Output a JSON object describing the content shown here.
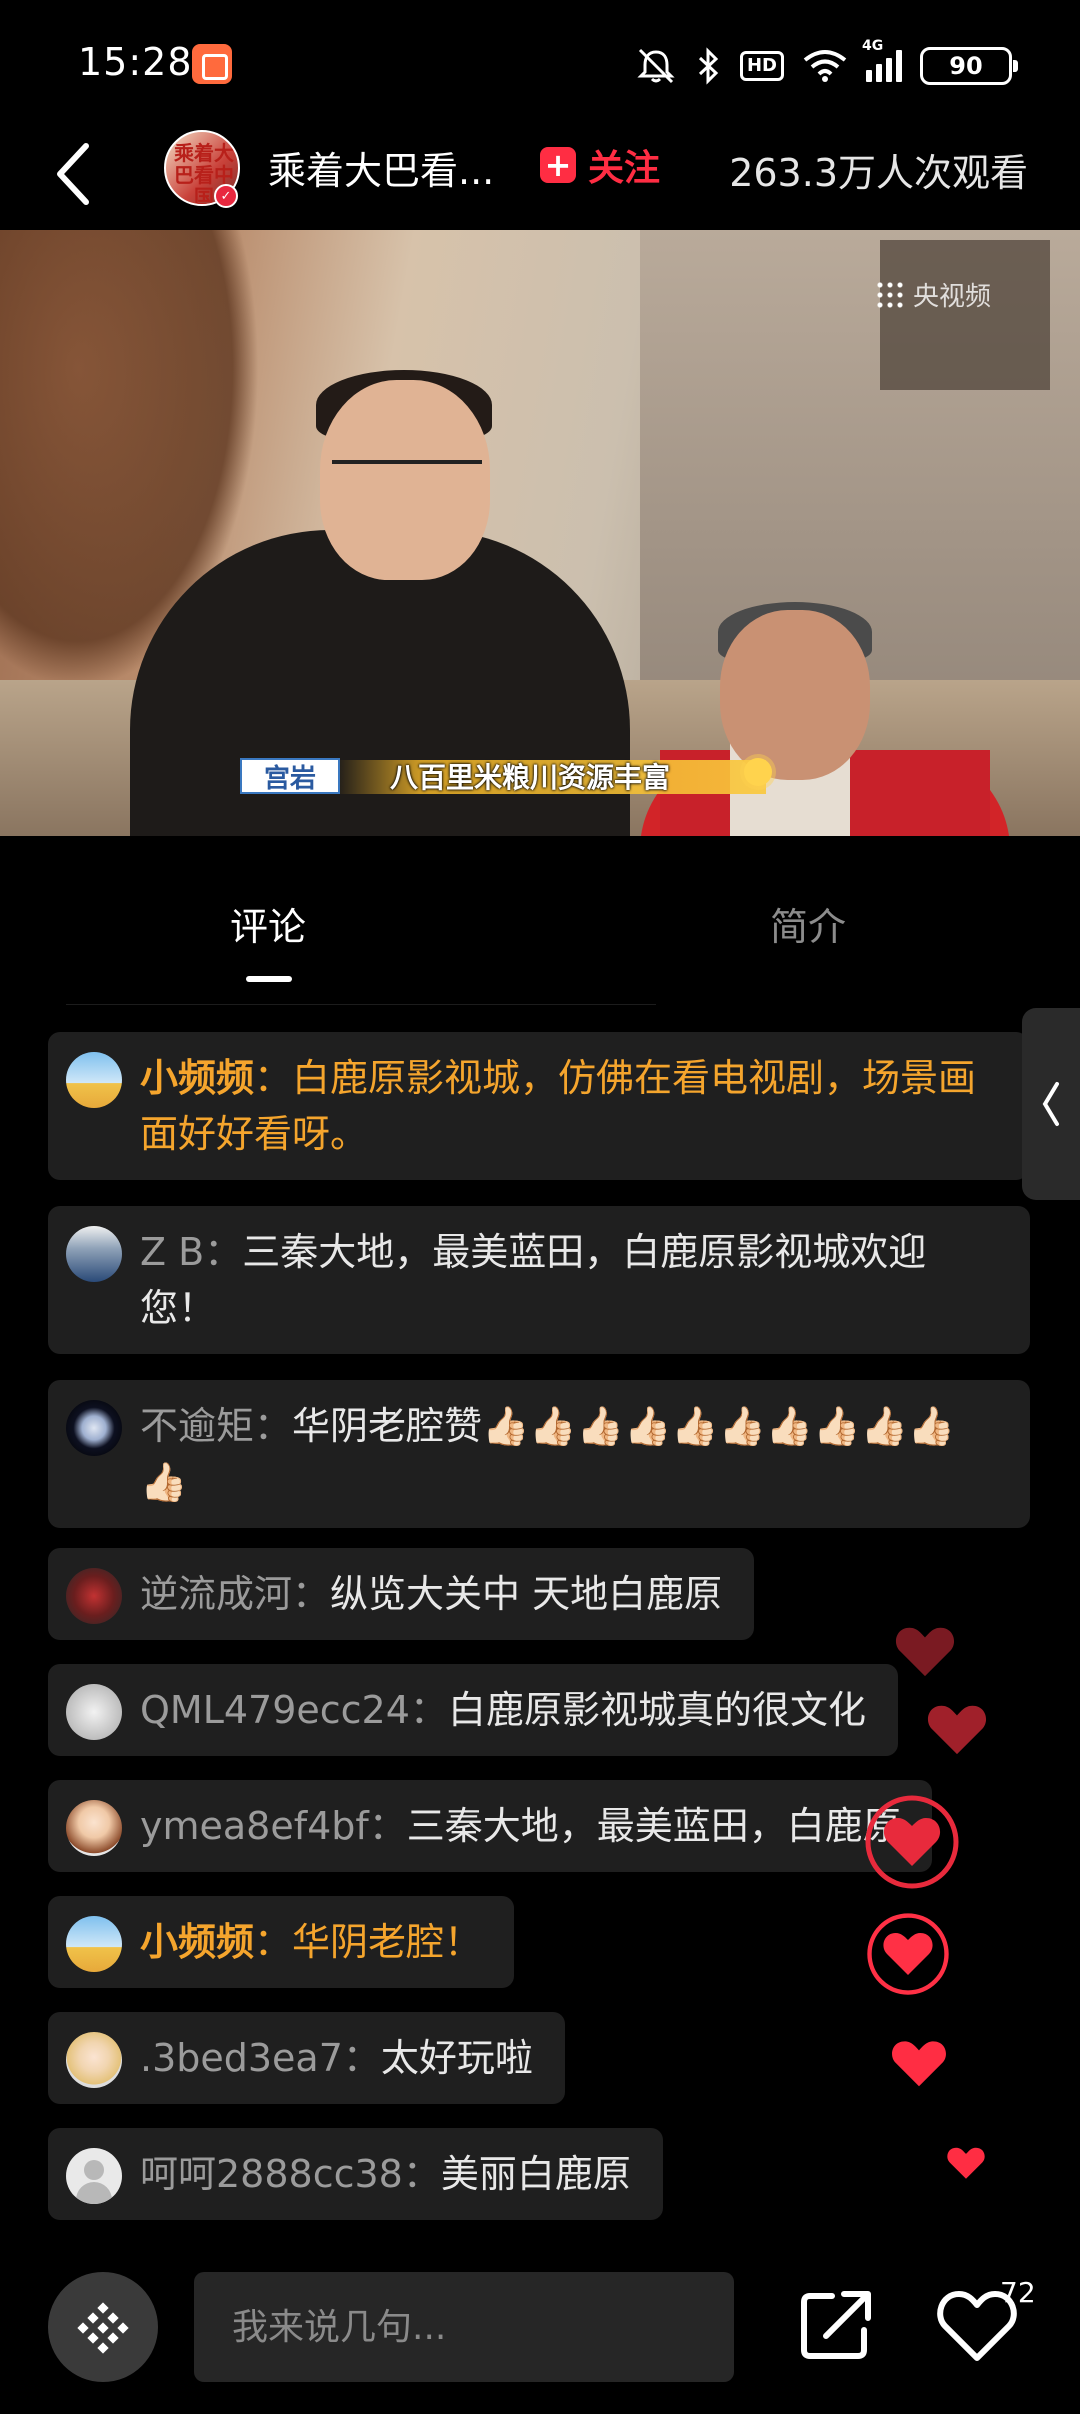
{
  "status_bar": {
    "time": "15:28",
    "hd_label": "HD",
    "network": "4G",
    "battery": "90"
  },
  "header": {
    "channel_name": "乘着大巴看...",
    "avatar_text": "乘着大巴看中国",
    "follow_label": "关注",
    "view_count": "263.3万人次观看"
  },
  "video": {
    "watermark": "央视频",
    "name_tag": "宫岩",
    "caption": "八百里米粮川资源丰富"
  },
  "tabs": [
    {
      "label": "评论",
      "active": true
    },
    {
      "label": "简介",
      "active": false
    }
  ],
  "comments": [
    {
      "user": "小频频",
      "text": "白鹿原影视城，仿佛在看电视剧，场景画面好好看呀。",
      "official": true,
      "avatar": "official"
    },
    {
      "user": "Z B",
      "text": "三秦大地，最美蓝田，白鹿原影视城欢迎您！",
      "official": false,
      "avatar": "zb"
    },
    {
      "user": "不逾矩",
      "text": "华阴老腔赞👍🏻👍🏻👍🏻👍🏻👍🏻👍🏻👍🏻👍🏻👍🏻👍🏻👍🏻",
      "official": false,
      "avatar": "moon"
    },
    {
      "user": "逆流成河",
      "text": "纵览大关中 天地白鹿原",
      "official": false,
      "avatar": "car"
    },
    {
      "user": "QML479ecc24",
      "text": "白鹿原影视城真的很文化",
      "official": false,
      "avatar": "sketch"
    },
    {
      "user": "ymea8ef4bf",
      "text": "三秦大地，最美蓝田，白鹿原",
      "official": false,
      "avatar": "girl"
    },
    {
      "user": "小频频",
      "text": "华阴老腔！",
      "official": true,
      "avatar": "official"
    },
    {
      "user": ".3bed3ea7",
      "text": "太好玩啦",
      "official": false,
      "avatar": "blonde"
    },
    {
      "user": "呵呵2888cc38",
      "text": "美丽白鹿原",
      "official": false,
      "avatar": "default"
    }
  ],
  "separator": "：",
  "bottom_bar": {
    "input_placeholder": "我来说几句...",
    "like_count": "72"
  },
  "colors": {
    "accent_red": "#ff2d43",
    "official_orange": "#f5a52d",
    "bubble_bg": "#1f1f1f"
  },
  "icons": [
    "back-arrow-icon",
    "mute-icon",
    "bluetooth-icon",
    "wifi-icon",
    "signal-icon",
    "battery-icon",
    "danmaku-icon",
    "share-icon",
    "heart-icon",
    "chevron-left-icon"
  ]
}
